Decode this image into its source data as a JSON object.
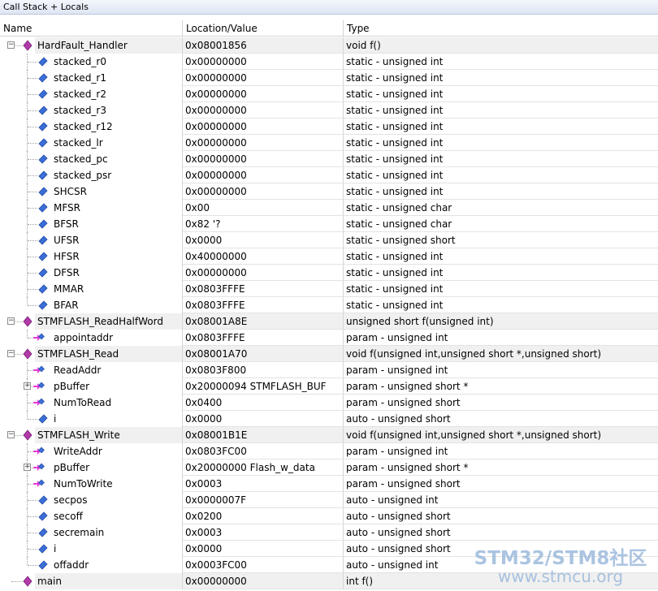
{
  "window": {
    "title": "Call Stack + Locals"
  },
  "columns": {
    "name": "Name",
    "value": "Location/Value",
    "type": "Type"
  },
  "rows": [
    {
      "kind": "fn",
      "name": "HardFault_Handler",
      "value": "0x08001856",
      "type": "void f()",
      "expander": "minus"
    },
    {
      "kind": "var",
      "name": "stacked_r0",
      "value": "0x00000000",
      "type": "static - unsigned int"
    },
    {
      "kind": "var",
      "name": "stacked_r1",
      "value": "0x00000000",
      "type": "static - unsigned int"
    },
    {
      "kind": "var",
      "name": "stacked_r2",
      "value": "0x00000000",
      "type": "static - unsigned int"
    },
    {
      "kind": "var",
      "name": "stacked_r3",
      "value": "0x00000000",
      "type": "static - unsigned int"
    },
    {
      "kind": "var",
      "name": "stacked_r12",
      "value": "0x00000000",
      "type": "static - unsigned int"
    },
    {
      "kind": "var",
      "name": "stacked_lr",
      "value": "0x00000000",
      "type": "static - unsigned int"
    },
    {
      "kind": "var",
      "name": "stacked_pc",
      "value": "0x00000000",
      "type": "static - unsigned int"
    },
    {
      "kind": "var",
      "name": "stacked_psr",
      "value": "0x00000000",
      "type": "static - unsigned int"
    },
    {
      "kind": "var",
      "name": "SHCSR",
      "value": "0x00000000",
      "type": "static - unsigned int"
    },
    {
      "kind": "var",
      "name": "MFSR",
      "value": "0x00",
      "type": "static - unsigned char"
    },
    {
      "kind": "var",
      "name": "BFSR",
      "value": "0x82 '?",
      "type": "static - unsigned char"
    },
    {
      "kind": "var",
      "name": "UFSR",
      "value": "0x0000",
      "type": "static - unsigned short"
    },
    {
      "kind": "var",
      "name": "HFSR",
      "value": "0x40000000",
      "type": "static - unsigned int"
    },
    {
      "kind": "var",
      "name": "DFSR",
      "value": "0x00000000",
      "type": "static - unsigned int"
    },
    {
      "kind": "var",
      "name": "MMAR",
      "value": "0x0803FFFE",
      "type": "static - unsigned int"
    },
    {
      "kind": "var",
      "name": "BFAR",
      "value": "0x0803FFFE",
      "type": "static - unsigned int"
    },
    {
      "kind": "fn",
      "name": "STMFLASH_ReadHalfWord",
      "value": "0x08001A8E",
      "type": "unsigned short f(unsigned int)",
      "expander": "minus"
    },
    {
      "kind": "param",
      "name": "appointaddr",
      "value": "0x0803FFFE",
      "type": "param - unsigned int"
    },
    {
      "kind": "fn",
      "name": "STMFLASH_Read",
      "value": "0x08001A70",
      "type": "void f(unsigned int,unsigned short *,unsigned short)",
      "expander": "minus"
    },
    {
      "kind": "param",
      "name": "ReadAddr",
      "value": "0x0803F800",
      "type": "param - unsigned int"
    },
    {
      "kind": "param",
      "name": "pBuffer",
      "value": "0x20000094 STMFLASH_BUF",
      "type": "param - unsigned short *",
      "expander": "plus"
    },
    {
      "kind": "param",
      "name": "NumToRead",
      "value": "0x0400",
      "type": "param - unsigned short"
    },
    {
      "kind": "var",
      "name": "i",
      "value": "0x0000",
      "type": "auto - unsigned short"
    },
    {
      "kind": "fn",
      "name": "STMFLASH_Write",
      "value": "0x08001B1E",
      "type": "void f(unsigned int,unsigned short *,unsigned short)",
      "expander": "minus"
    },
    {
      "kind": "param",
      "name": "WriteAddr",
      "value": "0x0803FC00",
      "type": "param - unsigned int"
    },
    {
      "kind": "param",
      "name": "pBuffer",
      "value": "0x20000000 Flash_w_data",
      "type": "param - unsigned short *",
      "expander": "plus"
    },
    {
      "kind": "param",
      "name": "NumToWrite",
      "value": "0x0003",
      "type": "param - unsigned short"
    },
    {
      "kind": "var",
      "name": "secpos",
      "value": "0x0000007F",
      "type": "auto - unsigned int"
    },
    {
      "kind": "var",
      "name": "secoff",
      "value": "0x0200",
      "type": "auto - unsigned short"
    },
    {
      "kind": "var",
      "name": "secremain",
      "value": "0x0003",
      "type": "auto - unsigned short"
    },
    {
      "kind": "var",
      "name": "i",
      "value": "0x0000",
      "type": "auto - unsigned short"
    },
    {
      "kind": "var",
      "name": "offaddr",
      "value": "0x0003FC00",
      "type": "auto - unsigned int"
    },
    {
      "kind": "fn",
      "name": "main",
      "value": "0x00000000",
      "type": "int f()"
    }
  ],
  "watermark": {
    "line1": "STM32/STM8社区",
    "line2": "www.stmcu.org"
  },
  "colors": {
    "function_icon": "#b03aa8",
    "variable_icon": "#3c6ed8",
    "param_arrow": "#e23ad6"
  }
}
